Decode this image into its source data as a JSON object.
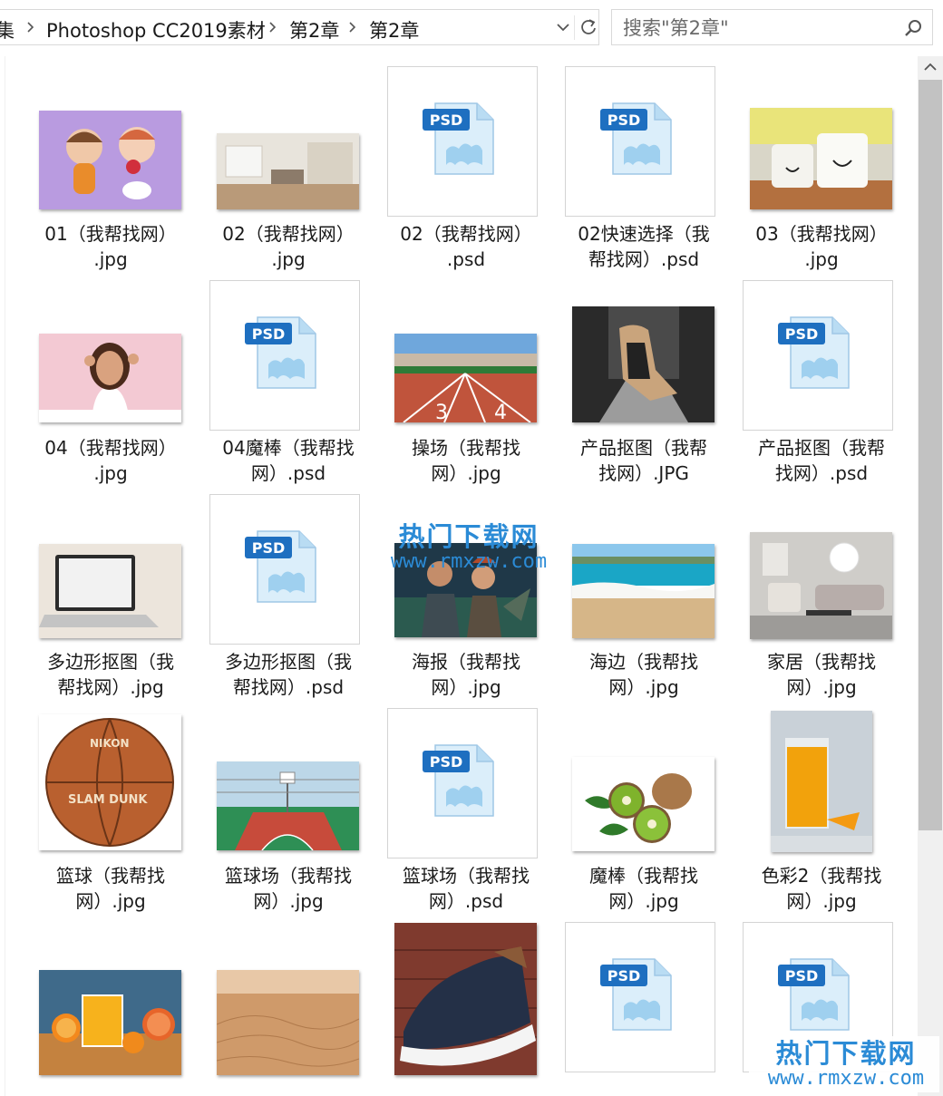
{
  "address_bar": {
    "crumbs": [
      "集",
      "Photoshop CC2019素材",
      "第2章",
      "第2章"
    ]
  },
  "search": {
    "placeholder": "搜索\"第2章\""
  },
  "files": [
    {
      "name": "01（我帮找网）.jpg",
      "line1": "01（我帮找网）",
      "line2": ".jpg",
      "kind": "image",
      "thumb": "dolls-thumbnail"
    },
    {
      "name": "02（我帮找网）.jpg",
      "line1": "02（我帮找网）",
      "line2": ".jpg",
      "kind": "image",
      "thumb": "living-room-thumbnail"
    },
    {
      "name": "02（我帮找网）.psd",
      "line1": "02（我帮找网）",
      "line2": ".psd",
      "kind": "psd",
      "thumb": "psd-file-icon"
    },
    {
      "name": "02快速选择（我帮找网）.psd",
      "line1": "02快速选择（我",
      "line2": "帮找网）.psd",
      "kind": "psd",
      "thumb": "psd-file-icon"
    },
    {
      "name": "03（我帮找网）.jpg",
      "line1": "03（我帮找网）",
      "line2": ".jpg",
      "kind": "image",
      "thumb": "cups-thumbnail"
    },
    {
      "name": "04（我帮找网）.jpg",
      "line1": "04（我帮找网）",
      "line2": ".jpg",
      "kind": "image",
      "thumb": "woman-thumbnail"
    },
    {
      "name": "04魔棒（我帮找网）.psd",
      "line1": "04魔棒（我帮找",
      "line2": "网）.psd",
      "kind": "psd",
      "thumb": "psd-file-icon"
    },
    {
      "name": "操场（我帮找网）.jpg",
      "line1": "操场（我帮找",
      "line2": "网）.jpg",
      "kind": "image",
      "thumb": "track-thumbnail"
    },
    {
      "name": "产品抠图（我帮找网）.JPG",
      "line1": "产品抠图（我帮",
      "line2": "找网）.JPG",
      "kind": "image",
      "thumb": "massage-chair-thumbnail"
    },
    {
      "name": "产品抠图（我帮找网）.psd",
      "line1": "产品抠图（我帮",
      "line2": "找网）.psd",
      "kind": "psd",
      "thumb": "psd-file-icon"
    },
    {
      "name": "多边形抠图（我帮找网）.jpg",
      "line1": "多边形抠图（我",
      "line2": "帮找网）.jpg",
      "kind": "image",
      "thumb": "laptop-thumbnail"
    },
    {
      "name": "多边形抠图（我帮找网）.psd",
      "line1": "多边形抠图（我",
      "line2": "帮找网）.psd",
      "kind": "psd",
      "thumb": "psd-file-icon"
    },
    {
      "name": "海报（我帮找网）.jpg",
      "line1": "海报（我帮找",
      "line2": "网）.jpg",
      "kind": "image",
      "thumb": "poster-thumbnail"
    },
    {
      "name": "海边（我帮找网）.jpg",
      "line1": "海边（我帮找",
      "line2": "网）.jpg",
      "kind": "image",
      "thumb": "beach-thumbnail"
    },
    {
      "name": "家居（我帮找网）.jpg",
      "line1": "家居（我帮找",
      "line2": "网）.jpg",
      "kind": "image",
      "thumb": "home-interior-thumbnail"
    },
    {
      "name": "篮球（我帮找网）.jpg",
      "line1": "篮球（我帮找",
      "line2": "网）.jpg",
      "kind": "image",
      "thumb": "basketball-thumbnail"
    },
    {
      "name": "篮球场（我帮找网）.jpg",
      "line1": "篮球场（我帮找",
      "line2": "网）.jpg",
      "kind": "image",
      "thumb": "court-thumbnail"
    },
    {
      "name": "篮球场（我帮找网）.psd",
      "line1": "篮球场（我帮找",
      "line2": "网）.psd",
      "kind": "psd",
      "thumb": "psd-file-icon"
    },
    {
      "name": "魔棒（我帮找网）.jpg",
      "line1": "魔棒（我帮找",
      "line2": "网）.jpg",
      "kind": "image",
      "thumb": "kiwi-thumbnail"
    },
    {
      "name": "色彩2（我帮找网）.jpg",
      "line1": "色彩2（我帮找",
      "line2": "网）.jpg",
      "kind": "image",
      "thumb": "orange-juice-thumbnail"
    },
    {
      "name": "",
      "line1": "",
      "line2": "",
      "kind": "image",
      "thumb": "juice-oranges-thumbnail"
    },
    {
      "name": "",
      "line1": "",
      "line2": "",
      "kind": "image",
      "thumb": "desert-thumbnail"
    },
    {
      "name": "",
      "line1": "",
      "line2": "",
      "kind": "image",
      "thumb": "sneaker-thumbnail"
    },
    {
      "name": "",
      "line1": "",
      "line2": "",
      "kind": "psd",
      "thumb": "psd-file-icon"
    },
    {
      "name": "",
      "line1": "",
      "line2": "",
      "kind": "psd",
      "thumb": "psd-file-icon"
    }
  ],
  "psd_badge": "PSD",
  "basketball_text": {
    "brand": "NIKON",
    "slogan": "SLAM DUNK"
  },
  "watermark": {
    "title": "热门下载网",
    "url": "www.rmxzw.com"
  },
  "colors": {
    "accent": "#2b8bd6",
    "scrollbar_thumb": "#c2c2c2",
    "psd_blue": "#1e6fc0"
  }
}
